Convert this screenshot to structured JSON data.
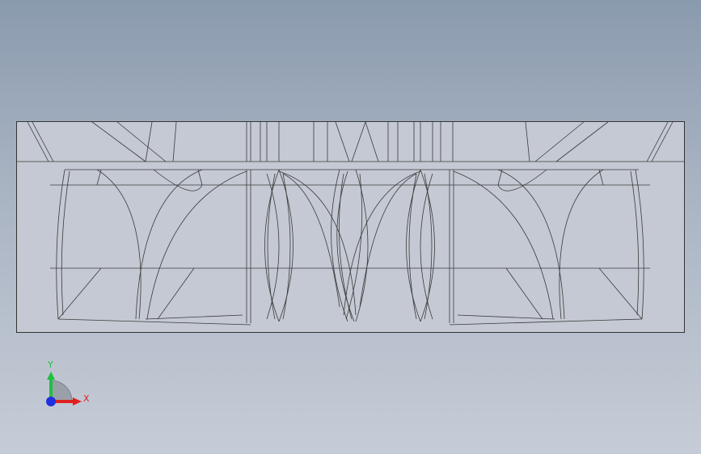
{
  "viewport": {
    "background_top": "#8a9aae",
    "background_bottom": "#c6ccd7",
    "model_face_color": "#c3c8d2",
    "edge_color": "#3a3a3a"
  },
  "triad": {
    "x_label": "X",
    "y_label": "Y",
    "x_color": "#e02020",
    "y_color": "#20c040",
    "z_color": "#2030e0"
  }
}
